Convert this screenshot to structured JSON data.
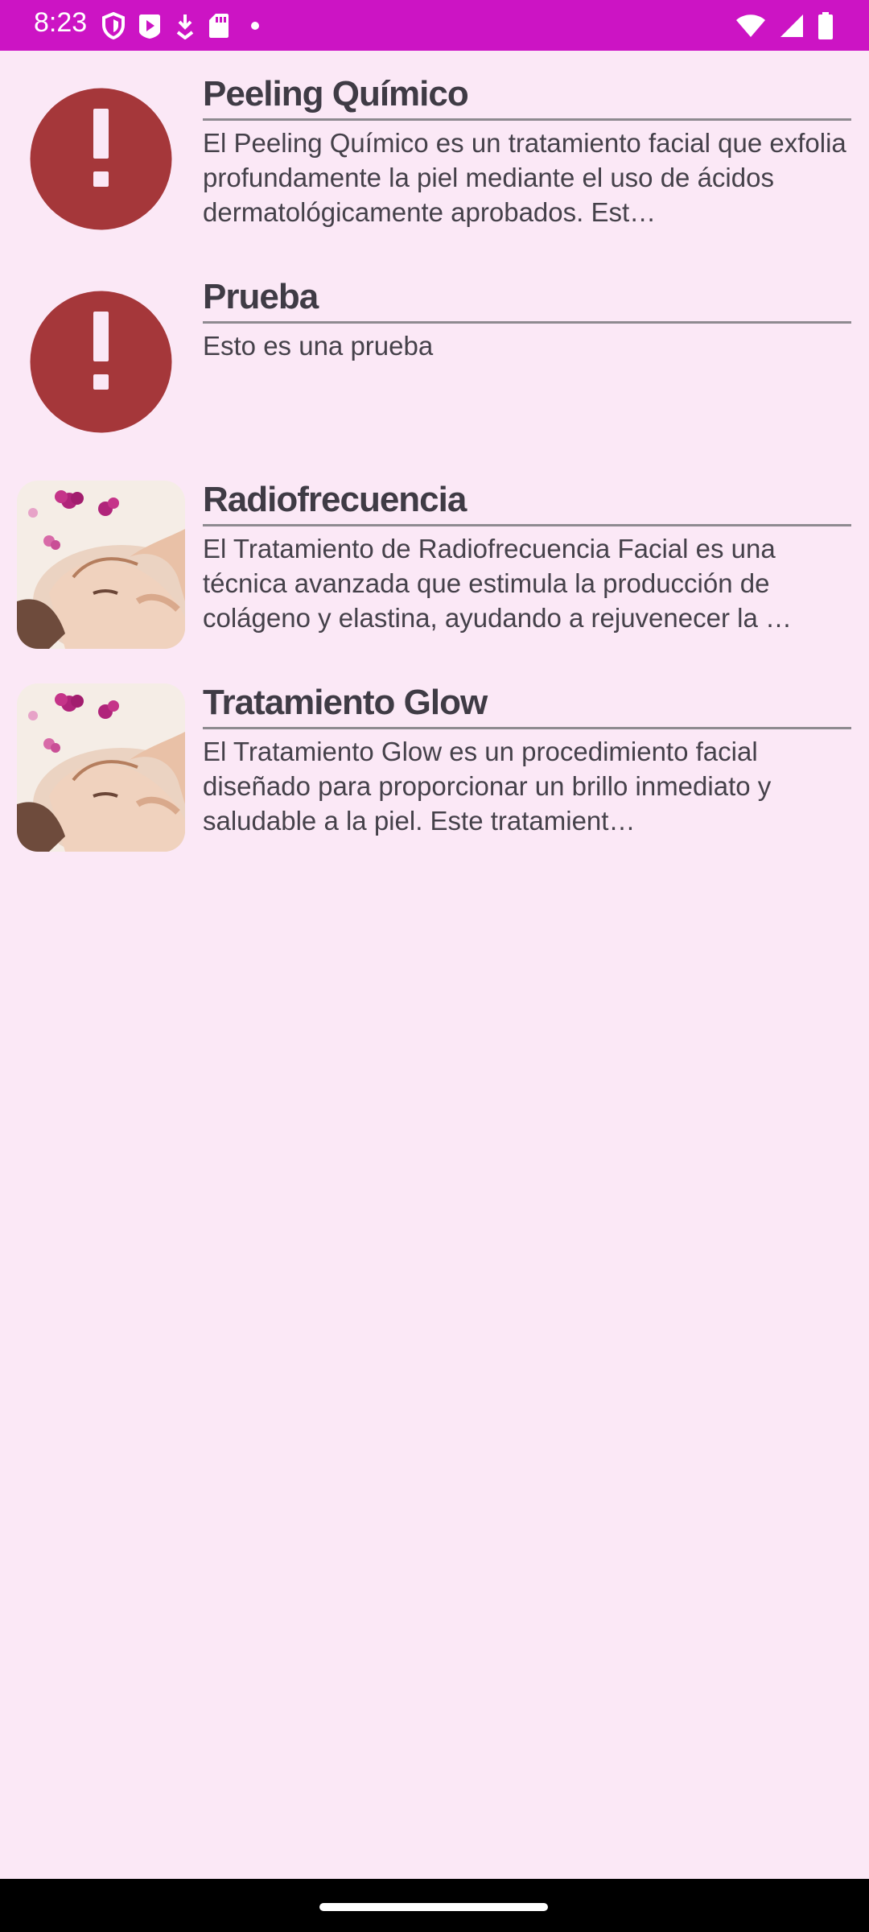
{
  "status_bar": {
    "time": "8:23",
    "background": "#CC14C4",
    "left_icons": [
      "shield-icon",
      "play-store-icon",
      "download-icon",
      "sd-card-icon",
      "dot-icon"
    ],
    "right_icons": [
      "wifi-icon",
      "signal-icon",
      "battery-icon"
    ]
  },
  "colors": {
    "background": "#FBE8F6",
    "alert_circle": "#A5373A",
    "title_text": "#3F3B45",
    "divider": "#8E8A90"
  },
  "items": [
    {
      "icon": "alert-icon",
      "title": "Peeling Químico",
      "description": "El Peeling Químico es un tratamiento facial que exfolia profundamente la piel mediante el uso de ácidos dermatológicamente aprobados. Est…"
    },
    {
      "icon": "alert-icon",
      "title": "Prueba",
      "description": "Esto es una prueba"
    },
    {
      "icon": "facial-treatment-photo",
      "title": "Radiofrecuencia",
      "description": "El Tratamiento de Radiofrecuencia Facial es una técnica avanzada que estimula la producción de colágeno y elastina, ayudando a rejuvenecer la …"
    },
    {
      "icon": "facial-treatment-photo",
      "title": "Tratamiento Glow",
      "description": "El Tratamiento Glow es un procedimiento facial diseñado para proporcionar un brillo inmediato y saludable a la piel. Este tratamient…"
    }
  ]
}
